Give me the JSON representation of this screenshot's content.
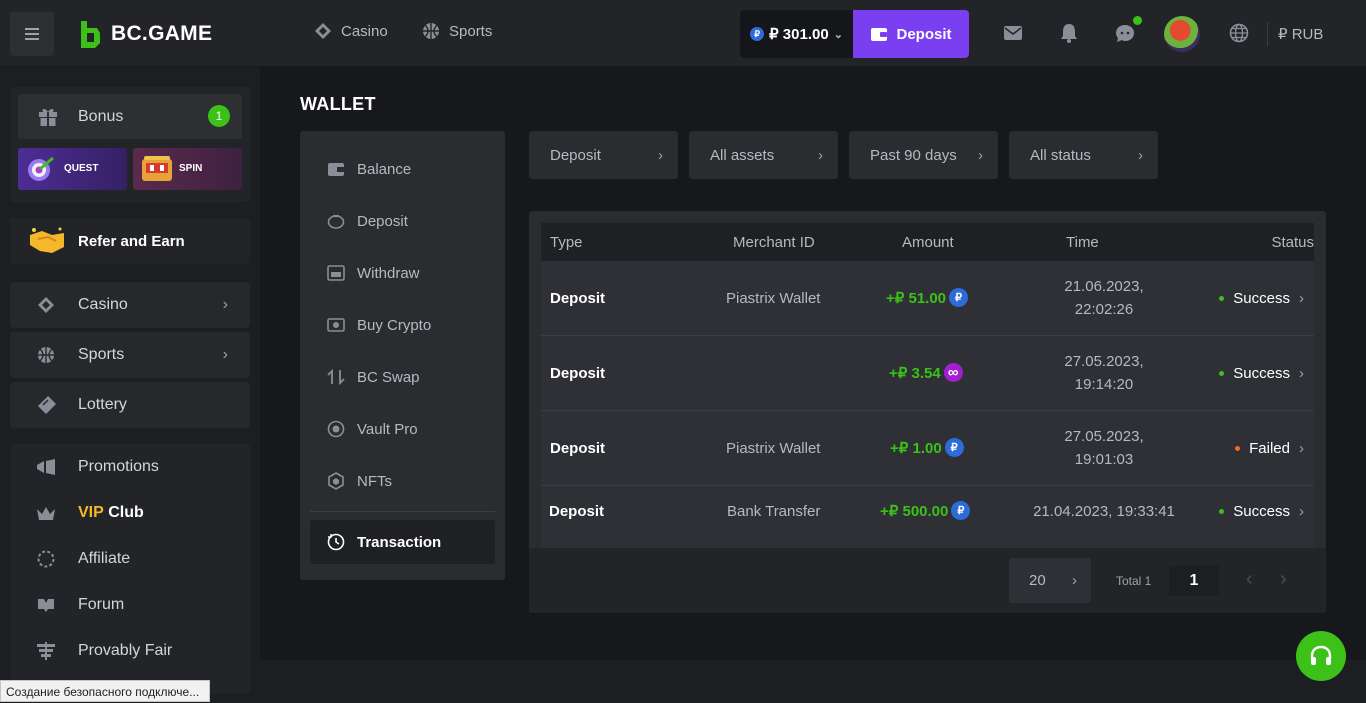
{
  "header": {
    "brand": "BC.GAME",
    "nav": [
      {
        "label": "Casino",
        "icon": "casino-icon"
      },
      {
        "label": "Sports",
        "icon": "sports-icon"
      }
    ],
    "balance": "₽ 301.00",
    "deposit_label": "Deposit",
    "currency": "₽ RUB",
    "icons": [
      "mail-icon",
      "bell-icon",
      "chat-icon",
      "globe-icon"
    ]
  },
  "sidebar": {
    "bonus": {
      "label": "Bonus",
      "badge": "1"
    },
    "quest_label": "QUEST",
    "spin_label": "SPIN",
    "refer_label": "Refer and Earn",
    "main_items": [
      {
        "label": "Casino",
        "icon": "casino-icon"
      },
      {
        "label": "Sports",
        "icon": "sports-icon"
      },
      {
        "label": "Lottery",
        "icon": "ticket-icon"
      }
    ],
    "promo_items": [
      {
        "label": "Promotions",
        "icon": "promotions-icon"
      },
      {
        "label_vip": "VIP",
        "label_club": "Club",
        "icon": "crown-icon"
      },
      {
        "label": "Affiliate",
        "icon": "affiliate-icon"
      },
      {
        "label": "Forum",
        "icon": "forum-icon"
      },
      {
        "label": "Provably Fair",
        "icon": "fair-icon"
      }
    ]
  },
  "wallet": {
    "title": "WALLET",
    "menu": [
      {
        "label": "Balance",
        "icon": "wallet-icon"
      },
      {
        "label": "Deposit",
        "icon": "piggy-icon"
      },
      {
        "label": "Withdraw",
        "icon": "withdraw-icon"
      },
      {
        "label": "Buy Crypto",
        "icon": "card-icon"
      },
      {
        "label": "BC Swap",
        "icon": "swap-icon"
      },
      {
        "label": "Vault Pro",
        "icon": "vault-icon"
      },
      {
        "label": "NFTs",
        "icon": "nft-icon"
      },
      {
        "label": "Transaction",
        "icon": "transaction-icon",
        "active": true
      }
    ],
    "filters": [
      "Deposit",
      "All assets",
      "Past 90 days",
      "All status"
    ],
    "table": {
      "headers": {
        "type": "Type",
        "merchant": "Merchant ID",
        "amount": "Amount",
        "time": "Time",
        "status": "Status"
      },
      "rows": [
        {
          "type": "Deposit",
          "merchant": "Piastrix Wallet",
          "amount": "+₽ 51.00",
          "coin": "ruble",
          "time1": "21.06.2023,",
          "time2": "22:02:26",
          "status": "Success",
          "status_color": "#3bc117"
        },
        {
          "type": "Deposit",
          "merchant": "",
          "amount": "+₽ 3.54",
          "coin": "infinity",
          "time1": "27.05.2023,",
          "time2": "19:14:20",
          "status": "Success",
          "status_color": "#3bc117"
        },
        {
          "type": "Deposit",
          "merchant": "Piastrix Wallet",
          "amount": "+₽ 1.00",
          "coin": "ruble",
          "time1": "27.05.2023,",
          "time2": "19:01:03",
          "status": "Failed",
          "status_color": "#ee6c1c"
        },
        {
          "type": "Deposit",
          "merchant": "Bank Transfer",
          "amount": "+₽ 500.00",
          "coin": "ruble",
          "time1": "21.04.2023, 19:33:41",
          "time2": "",
          "status": "Success",
          "status_color": "#3bc117"
        }
      ]
    },
    "pagination": {
      "per_page": "20",
      "total": "Total 1",
      "page": "1"
    }
  },
  "browser_status": "Создание безопасного подключе...",
  "colors": {
    "accent": "#7a3ff0",
    "success": "#3bc117",
    "failed": "#ee6c1c"
  }
}
